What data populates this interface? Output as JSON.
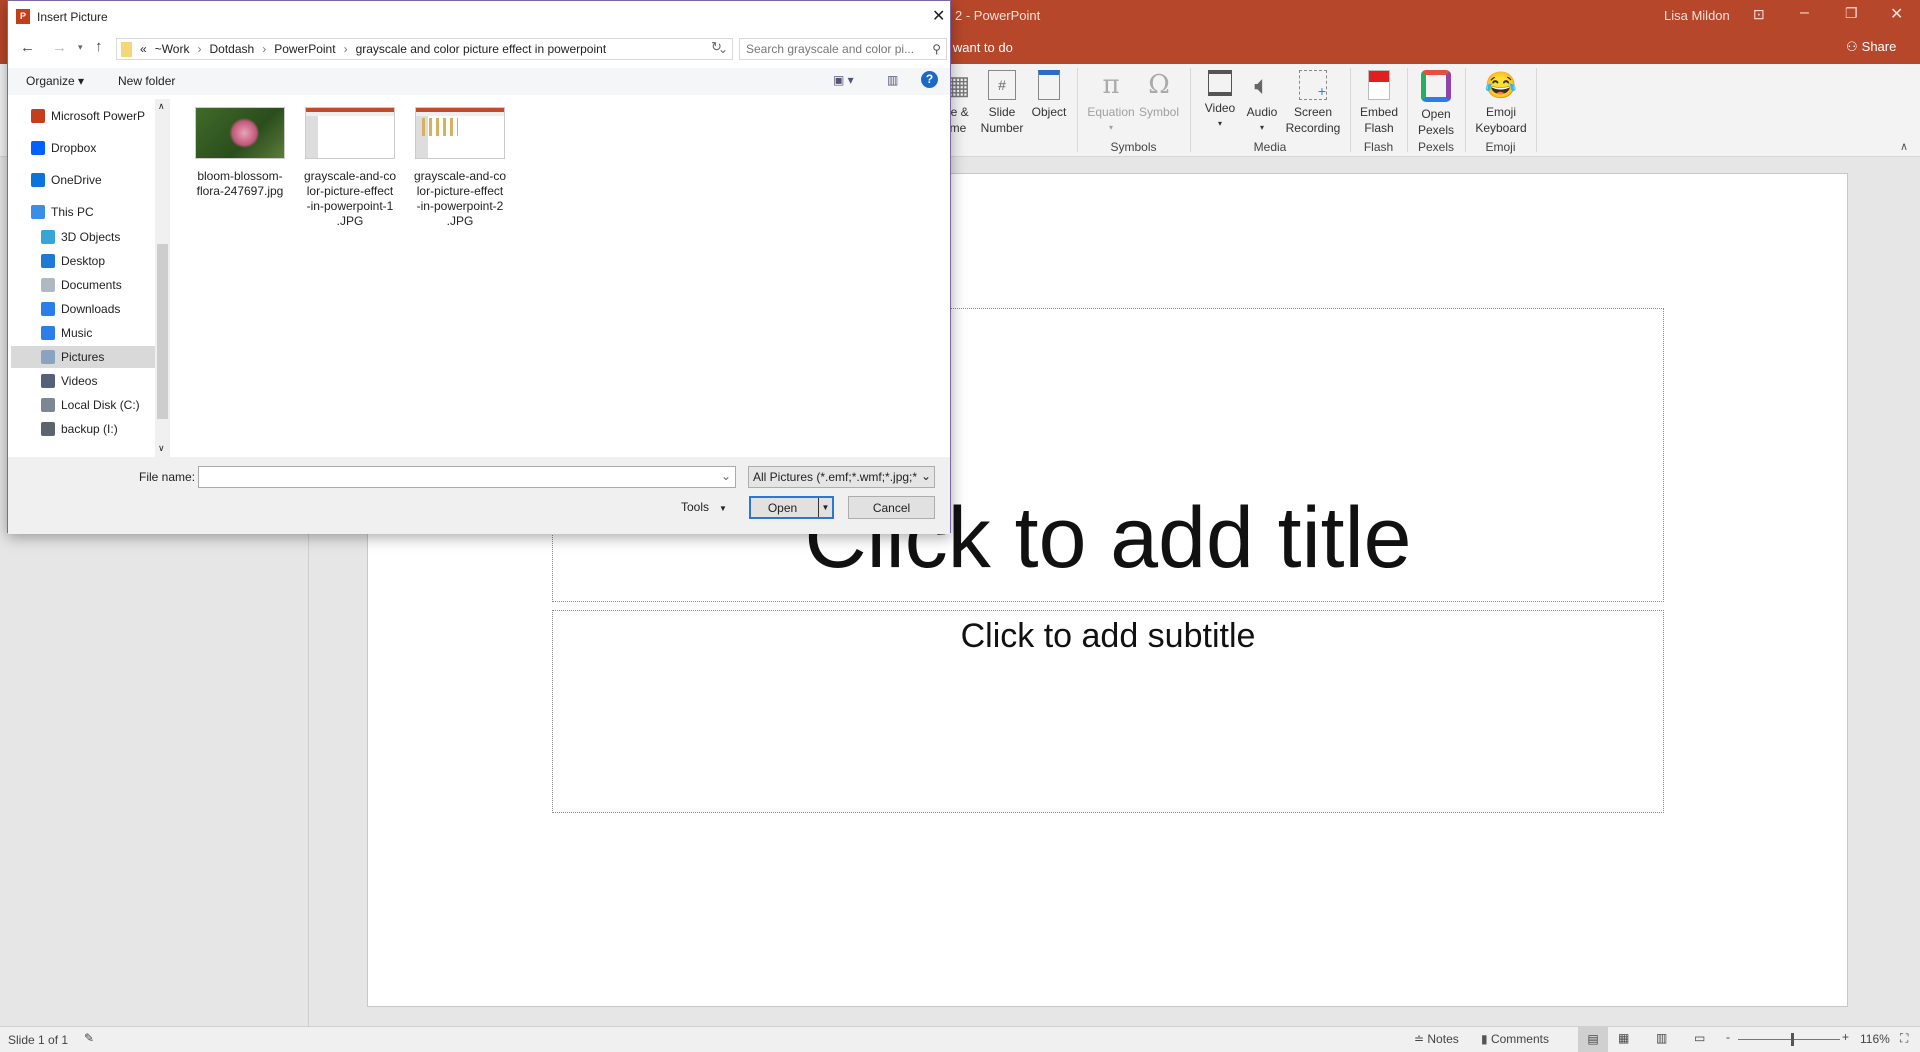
{
  "app": {
    "title_fragment": "2  -  PowerPoint",
    "user": "Lisa Mildon",
    "tell_me_fragment": "u want to do",
    "share": "Share"
  },
  "ribbon": {
    "items": [
      {
        "l1": "te &",
        "l2": "me",
        "icon": "calendar-clock-icon"
      },
      {
        "l1": "Slide",
        "l2": "Number",
        "icon": "slide-number-icon"
      },
      {
        "l1": "Object",
        "l2": "",
        "icon": "object-icon"
      },
      {
        "l1": "Equation",
        "l2": "▾",
        "icon": "pi-icon",
        "disabled": true
      },
      {
        "l1": "Symbol",
        "l2": "",
        "icon": "omega-icon",
        "disabled": true
      },
      {
        "l1": "Video",
        "l2": "▾",
        "icon": "film-icon"
      },
      {
        "l1": "Audio",
        "l2": "▾",
        "icon": "speaker-icon"
      },
      {
        "l1": "Screen",
        "l2": "Recording",
        "icon": "screen-recording-icon"
      },
      {
        "l1": "Embed",
        "l2": "Flash",
        "icon": "flash-pdf-icon"
      },
      {
        "l1": "Open",
        "l2": "Pexels",
        "icon": "pexels-icon"
      },
      {
        "l1": "Emoji",
        "l2": "Keyboard",
        "icon": "emoji-icon"
      }
    ],
    "groups": [
      "Symbols",
      "Media",
      "Flash",
      "Pexels",
      "Emoji"
    ]
  },
  "slide": {
    "title_placeholder": "Click to add title",
    "subtitle_placeholder": "Click to add subtitle"
  },
  "status": {
    "slide_info": "Slide 1 of 1",
    "notes": "Notes",
    "comments": "Comments",
    "zoom": "116%",
    "zoom_level_percent": 116
  },
  "dialog": {
    "title": "Insert Picture",
    "breadcrumb": [
      "«",
      "~Work",
      "Dotdash",
      "PowerPoint",
      "grayscale and color picture effect in powerpoint"
    ],
    "search_placeholder": "Search grayscale and color pi...",
    "organize": "Organize ▾",
    "new_folder": "New folder",
    "nav": [
      {
        "label": "Microsoft PowerP",
        "icon": "powerpoint-icon",
        "color": "#c43e1c",
        "indent": 0
      },
      {
        "label": "Dropbox",
        "icon": "dropbox-icon",
        "color": "#0061fe",
        "indent": 0
      },
      {
        "label": "OneDrive",
        "icon": "onedrive-icon",
        "color": "#0a74da",
        "indent": 0
      },
      {
        "label": "This PC",
        "icon": "computer-icon",
        "color": "#3a8ee6",
        "indent": 0
      },
      {
        "label": "3D Objects",
        "icon": "cube-icon",
        "color": "#37a5d8",
        "indent": 1
      },
      {
        "label": "Desktop",
        "icon": "desktop-icon",
        "color": "#1e7ad6",
        "indent": 1
      },
      {
        "label": "Documents",
        "icon": "document-icon",
        "color": "#b0b8c4",
        "indent": 1
      },
      {
        "label": "Downloads",
        "icon": "download-icon",
        "color": "#2b7de9",
        "indent": 1
      },
      {
        "label": "Music",
        "icon": "music-icon",
        "color": "#2b7de9",
        "indent": 1
      },
      {
        "label": "Pictures",
        "icon": "pictures-icon",
        "color": "#8aa4c0",
        "indent": 1,
        "selected": true
      },
      {
        "label": "Videos",
        "icon": "videos-icon",
        "color": "#55607a",
        "indent": 1
      },
      {
        "label": "Local Disk (C:)",
        "icon": "disk-icon",
        "color": "#7d8794",
        "indent": 1
      },
      {
        "label": "backup (I:)",
        "icon": "drive-icon",
        "color": "#5d6470",
        "indent": 1
      }
    ],
    "files": [
      {
        "name": "bloom-blossom-flora-247697.jpg",
        "lines": [
          "bloom-blossom-",
          "flora-247697.jpg"
        ],
        "kind": "photo"
      },
      {
        "name": "grayscale-and-color-picture-effect-in-powerpoint-1.JPG",
        "lines": [
          "grayscale-and-co",
          "lor-picture-effect",
          "-in-powerpoint-1",
          ".JPG"
        ],
        "kind": "slide"
      },
      {
        "name": "grayscale-and-color-picture-effect-in-powerpoint-2.JPG",
        "lines": [
          "grayscale-and-co",
          "lor-picture-effect",
          "-in-powerpoint-2",
          ".JPG"
        ],
        "kind": "slide2"
      }
    ],
    "file_name_label": "File name:",
    "file_name_value": "",
    "filter": "All Pictures (*.emf;*.wmf;*.jpg;*",
    "tools": "Tools",
    "open": "Open",
    "cancel": "Cancel"
  }
}
